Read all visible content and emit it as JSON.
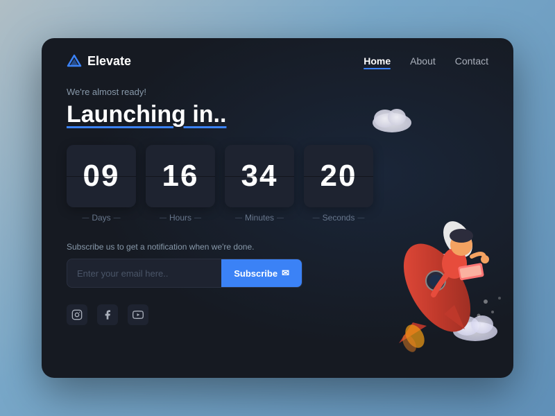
{
  "page": {
    "background": "#161a22"
  },
  "nav": {
    "logo_text": "Elevate",
    "links": [
      {
        "label": "Home",
        "active": true
      },
      {
        "label": "About",
        "active": false
      },
      {
        "label": "Contact",
        "active": false
      }
    ]
  },
  "hero": {
    "subtitle": "We're almost ready!",
    "headline": "Launching in.."
  },
  "countdown": [
    {
      "value": "09",
      "label": "Days"
    },
    {
      "value": "16",
      "label": "Hours"
    },
    {
      "value": "34",
      "label": "Minutes"
    },
    {
      "value": "20",
      "label": "Seconds"
    }
  ],
  "subscribe": {
    "label": "Subscribe us to get a notification when we're done.",
    "placeholder": "Enter your email here..",
    "button_label": "Subscribe"
  },
  "social": [
    {
      "name": "instagram",
      "icon": "📷"
    },
    {
      "name": "facebook",
      "icon": "f"
    },
    {
      "name": "youtube",
      "icon": "▶"
    }
  ]
}
